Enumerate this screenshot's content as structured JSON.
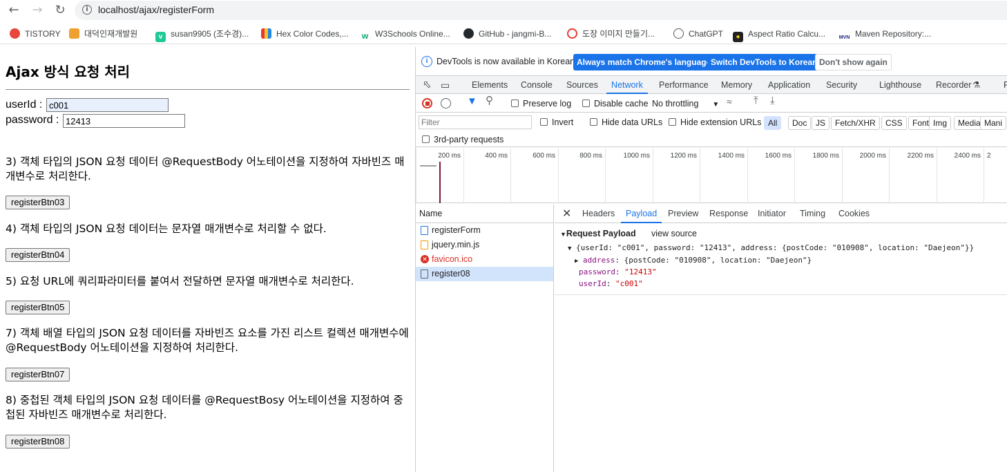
{
  "browser": {
    "url": "localhost/ajax/registerForm",
    "bookmarks": [
      "TISTORY",
      "대덕인재개발원",
      "susan9905 (조수경)...",
      "Hex Color Codes,...",
      "W3Schools Online...",
      "GitHub - jangmi-B...",
      "도장 이미지 만들기...",
      "ChatGPT",
      "Aspect Ratio Calcu...",
      "Maven Repository:..."
    ]
  },
  "page": {
    "title": "Ajax 방식 요청 처리",
    "userid_label": "userId :",
    "userid_value": "c001",
    "password_label": "password :",
    "password_value": "12413",
    "items": [
      {
        "text": "3) 객체 타입의 JSON 요청 데이터 @RequestBody 어노테이션을 지정하여 자바빈즈 매개변수로 처리한다.",
        "button": "registerBtn03"
      },
      {
        "text": "4) 객체 타입의 JSON 요청 데이터는 문자열 매개변수로 처리할 수 없다.",
        "button": "registerBtn04"
      },
      {
        "text": "5) 요청 URL에 쿼리파라미터를 붙여서 전달하면 문자열 매개변수로 처리한다.",
        "button": "registerBtn05"
      },
      {
        "text": "7) 객체 배열 타입의 JSON 요청 데이터를 자바빈즈 요소를 가진 리스트 컬렉션 매개변수에 @RequestBody 어노테이션을 지정하여 처리한다.",
        "button": "registerBtn07"
      },
      {
        "text": "8) 중첩된 객체 타입의 JSON 요청 데이터를 @RequestBosy 어노테이션을 지정하여 중첩된 자바빈즈 매개변수로 처리한다.",
        "button": "registerBtn08"
      }
    ]
  },
  "devtools": {
    "infobar_text": "DevTools is now available in Korean!",
    "btn_match": "Always match Chrome's language",
    "btn_switch": "Switch DevTools to Korean",
    "btn_dismiss": "Don't show again",
    "tabs": [
      "Elements",
      "Console",
      "Sources",
      "Network",
      "Performance",
      "Memory",
      "Application",
      "Security",
      "Lighthouse",
      "Recorder"
    ],
    "active_tab": "Network",
    "overflow_tab": "P",
    "preserve_log": "Preserve log",
    "disable_cache": "Disable cache",
    "throttling": "No throttling",
    "filter_placeholder": "Filter",
    "invert": "Invert",
    "hide_data_urls": "Hide data URLs",
    "hide_ext_urls": "Hide extension URLs",
    "type_filters": [
      "All",
      "Doc",
      "JS",
      "Fetch/XHR",
      "CSS",
      "Font",
      "Img",
      "Media",
      "Mani"
    ],
    "third_party": "3rd-party requests",
    "timeline_ticks": [
      "200 ms",
      "400 ms",
      "600 ms",
      "800 ms",
      "1000 ms",
      "1200 ms",
      "1400 ms",
      "1600 ms",
      "1800 ms",
      "2000 ms",
      "2200 ms",
      "2400 ms",
      "2"
    ],
    "name_header": "Name",
    "requests": [
      {
        "name": "registerForm",
        "type": "doc"
      },
      {
        "name": "jquery.min.js",
        "type": "js"
      },
      {
        "name": "favicon.ico",
        "type": "error"
      },
      {
        "name": "register08",
        "type": "xhr"
      }
    ],
    "detail_tabs": [
      "Headers",
      "Payload",
      "Preview",
      "Response",
      "Initiator",
      "Timing",
      "Cookies"
    ],
    "active_detail_tab": "Payload",
    "payload": {
      "section_title": "Request Payload",
      "view_source": "view source",
      "summary": "{userId: \"c001\", password: \"12413\", address: {postCode: \"010908\", location: \"Daejeon\"}}",
      "address_key": "address",
      "address_val": "{postCode: \"010908\", location: \"Daejeon\"}",
      "password_key": "password",
      "password_val": "\"12413\"",
      "userid_key": "userId",
      "userid_val": "\"c001\""
    }
  }
}
